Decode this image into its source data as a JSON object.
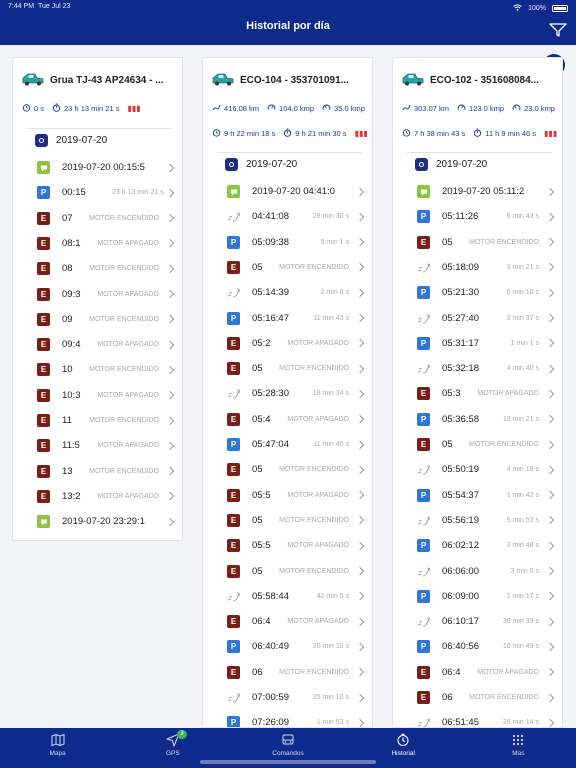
{
  "status_bar": {
    "time": "7:44 PM",
    "date": "Tue Jul 23",
    "battery": "100%"
  },
  "header": {
    "title": "Historial por día"
  },
  "cards": [
    {
      "vehicle_name": "Grua TJ-43 AP24634 - ...",
      "stats_row1": [],
      "stats_row2": [
        {
          "icon": "timer-icon",
          "value": "0 s"
        },
        {
          "icon": "stopwatch-icon",
          "value": "23 h 13 min 21 s"
        }
      ],
      "date": "2019-07-20",
      "events": [
        {
          "type": "green",
          "time": "2019-07-20 00:15:5",
          "label": ""
        },
        {
          "type": "blue",
          "letter": "P",
          "time": "00:15",
          "label": "23 h 13 min 21 s"
        },
        {
          "type": "brown",
          "letter": "E",
          "time": "07",
          "label": "MOTOR ENCENDIDO"
        },
        {
          "type": "brown",
          "letter": "E",
          "time": "08:1",
          "label": "MOTOR APAGADO"
        },
        {
          "type": "brown",
          "letter": "E",
          "time": "08",
          "label": "MOTOR ENCENDIDO"
        },
        {
          "type": "brown",
          "letter": "E",
          "time": "09:3",
          "label": "MOTOR APAGADO"
        },
        {
          "type": "brown",
          "letter": "E",
          "time": "09",
          "label": "MOTOR ENCENDIDO"
        },
        {
          "type": "brown",
          "letter": "E",
          "time": "09:4",
          "label": "MOTOR APAGADO"
        },
        {
          "type": "brown",
          "letter": "E",
          "time": "10",
          "label": "MOTOR ENCENDIDO"
        },
        {
          "type": "brown",
          "letter": "E",
          "time": "10:3",
          "label": "MOTOR APAGADO"
        },
        {
          "type": "brown",
          "letter": "E",
          "time": "11",
          "label": "MOTOR ENCENDIDO"
        },
        {
          "type": "brown",
          "letter": "E",
          "time": "11:5",
          "label": "MOTOR APAGADO"
        },
        {
          "type": "brown",
          "letter": "E",
          "time": "13",
          "label": "MOTOR ENCENDIDO"
        },
        {
          "type": "brown",
          "letter": "E",
          "time": "13:2",
          "label": "MOTOR APAGADO"
        },
        {
          "type": "green",
          "time": "2019-07-20 23:29:1",
          "label": ""
        }
      ]
    },
    {
      "vehicle_name": "ECO-104 - 353701091...",
      "stats_row1": [
        {
          "icon": "distance-icon",
          "value": "416.08 km"
        },
        {
          "icon": "speed-icon",
          "value": "104.0 kmp"
        },
        {
          "icon": "speed-avg-icon",
          "value": "35.0 kmp"
        }
      ],
      "stats_row2": [
        {
          "icon": "timer-icon",
          "value": "9 h 22 min 18 s"
        },
        {
          "icon": "stopwatch-icon",
          "value": "9 h 21 min 30 s"
        }
      ],
      "date": "2019-07-20",
      "events": [
        {
          "type": "green",
          "time": "2019-07-20 04:41:0",
          "label": ""
        },
        {
          "type": "move",
          "time": "04:41:08",
          "label": "28 min 30 s"
        },
        {
          "type": "blue",
          "letter": "P",
          "time": "05:09:38",
          "label": "5 min 1 s"
        },
        {
          "type": "brown",
          "letter": "E",
          "time": "05",
          "label": "MOTOR ENCENDIDO"
        },
        {
          "type": "move",
          "time": "05:14:39",
          "label": "2 min 8 s"
        },
        {
          "type": "blue",
          "letter": "P",
          "time": "05:16:47",
          "label": "11 min 43 s"
        },
        {
          "type": "brown",
          "letter": "E",
          "time": "05:2",
          "label": "MOTOR APAGADO"
        },
        {
          "type": "brown",
          "letter": "E",
          "time": "05",
          "label": "MOTOR ENCENDIDO"
        },
        {
          "type": "move",
          "time": "05:28:30",
          "label": "18 min 34 s"
        },
        {
          "type": "brown",
          "letter": "E",
          "time": "05:4",
          "label": "MOTOR APAGADO"
        },
        {
          "type": "blue",
          "letter": "P",
          "time": "05:47:04",
          "label": "11 min 40 s"
        },
        {
          "type": "brown",
          "letter": "E",
          "time": "05",
          "label": "MOTOR ENCENDIDO"
        },
        {
          "type": "brown",
          "letter": "E",
          "time": "05:5",
          "label": "MOTOR APAGADO"
        },
        {
          "type": "brown",
          "letter": "E",
          "time": "05",
          "label": "MOTOR ENCENDIDO"
        },
        {
          "type": "brown",
          "letter": "E",
          "time": "05:5",
          "label": "MOTOR APAGADO"
        },
        {
          "type": "brown",
          "letter": "E",
          "time": "05",
          "label": "MOTOR ENCENDIDO"
        },
        {
          "type": "move",
          "time": "05:58:44",
          "label": "42 min 5 s"
        },
        {
          "type": "brown",
          "letter": "E",
          "time": "06:4",
          "label": "MOTOR APAGADO"
        },
        {
          "type": "blue",
          "letter": "P",
          "time": "06:40:49",
          "label": "20 min 10 s"
        },
        {
          "type": "brown",
          "letter": "E",
          "time": "06",
          "label": "MOTOR ENCENDIDO"
        },
        {
          "type": "move",
          "time": "07:00:59",
          "label": "25 min 10 s"
        },
        {
          "type": "blue",
          "letter": "P",
          "time": "07:26:09",
          "label": "1 min 53 s"
        }
      ]
    },
    {
      "vehicle_name": "ECO-102 - 351608084...",
      "stats_row1": [
        {
          "icon": "distance-icon",
          "value": "303.07 km"
        },
        {
          "icon": "speed-icon",
          "value": "123.0 kmp"
        },
        {
          "icon": "speed-avg-icon",
          "value": "23.0 kmp"
        }
      ],
      "stats_row2": [
        {
          "icon": "timer-icon",
          "value": "7 h 38 min 43 s"
        },
        {
          "icon": "stopwatch-icon",
          "value": "11 h 9 min 46 s"
        }
      ],
      "date": "2019-07-20",
      "events": [
        {
          "type": "green",
          "time": "2019-07-20 05:11:2",
          "label": ""
        },
        {
          "type": "blue",
          "letter": "P",
          "time": "05:11:26",
          "label": "6 min 43 s"
        },
        {
          "type": "brown",
          "letter": "E",
          "time": "05",
          "label": "MOTOR ENCENDIDO"
        },
        {
          "type": "move",
          "time": "05:18:09",
          "label": "3 min 21 s"
        },
        {
          "type": "blue",
          "letter": "P",
          "time": "05:21:30",
          "label": "6 min 10 s"
        },
        {
          "type": "move",
          "time": "05:27:40",
          "label": "3 min 37 s"
        },
        {
          "type": "blue",
          "letter": "P",
          "time": "05:31:17",
          "label": "1 min 1 s"
        },
        {
          "type": "move",
          "time": "05:32:18",
          "label": "4 min 40 s"
        },
        {
          "type": "brown",
          "letter": "E",
          "time": "05:3",
          "label": "MOTOR APAGADO"
        },
        {
          "type": "blue",
          "letter": "P",
          "time": "05:36:58",
          "label": "13 min 21 s"
        },
        {
          "type": "brown",
          "letter": "E",
          "time": "05",
          "label": "MOTOR ENCENDIDO"
        },
        {
          "type": "move",
          "time": "05:50:19",
          "label": "4 min 18 s"
        },
        {
          "type": "blue",
          "letter": "P",
          "time": "05:54:37",
          "label": "1 min 42 s"
        },
        {
          "type": "move",
          "time": "05:56:19",
          "label": "5 min 53 s"
        },
        {
          "type": "blue",
          "letter": "P",
          "time": "06:02:12",
          "label": "3 min 48 s"
        },
        {
          "type": "move",
          "time": "06:06:00",
          "label": "3 min 0 s"
        },
        {
          "type": "blue",
          "letter": "P",
          "time": "06:09:00",
          "label": "1 min 17 s"
        },
        {
          "type": "move",
          "time": "06:10:17",
          "label": "30 min 39 s"
        },
        {
          "type": "blue",
          "letter": "P",
          "time": "06:40:56",
          "label": "10 min 49 s"
        },
        {
          "type": "brown",
          "letter": "E",
          "time": "06:4",
          "label": "MOTOR APAGADO"
        },
        {
          "type": "brown",
          "letter": "E",
          "time": "06",
          "label": "MOTOR ENCENDIDO"
        },
        {
          "type": "move",
          "time": "06:51:45",
          "label": "26 min 14 s"
        }
      ]
    }
  ],
  "tabbar": {
    "items": [
      {
        "label": "Mapa",
        "icon": "map-icon"
      },
      {
        "label": "GPS",
        "icon": "gps-arrow-icon",
        "badge": "3"
      },
      {
        "label": "Comandos",
        "icon": "bus-icon"
      },
      {
        "label": "Historial",
        "icon": "history-clock-icon",
        "active": true
      },
      {
        "label": "Mas",
        "icon": "grid-icon"
      }
    ]
  },
  "colors": {
    "primary": "#0d2a8c",
    "green": "#8bc53f",
    "blue": "#2f77d6",
    "brown": "#7a1e16",
    "accent_text": "#1a3aa8"
  }
}
